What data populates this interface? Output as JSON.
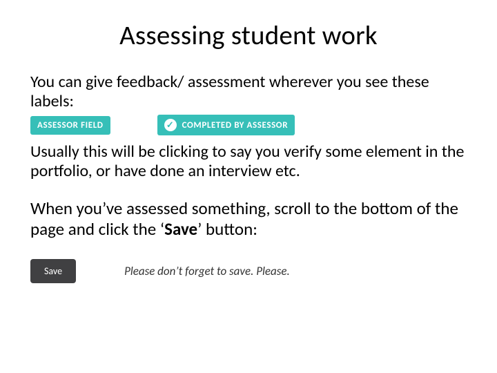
{
  "title": "Assessing student work",
  "intro": "You can give feedback/ assessment wherever you see these labels:",
  "badges": {
    "assessor_field": "ASSESSOR FIELD",
    "completed_by_assessor": "COMPLETED BY ASSESSOR"
  },
  "usually": "Usually this will be clicking to say you verify some element in the portfolio, or have done an interview etc.",
  "when_prefix": "When you’ve assessed something, scroll to the bottom of the page and click the ‘",
  "when_bold": "Save",
  "when_suffix": "’ button:",
  "save_label": "Save",
  "reminder": "Please don’t forget to save. Please."
}
